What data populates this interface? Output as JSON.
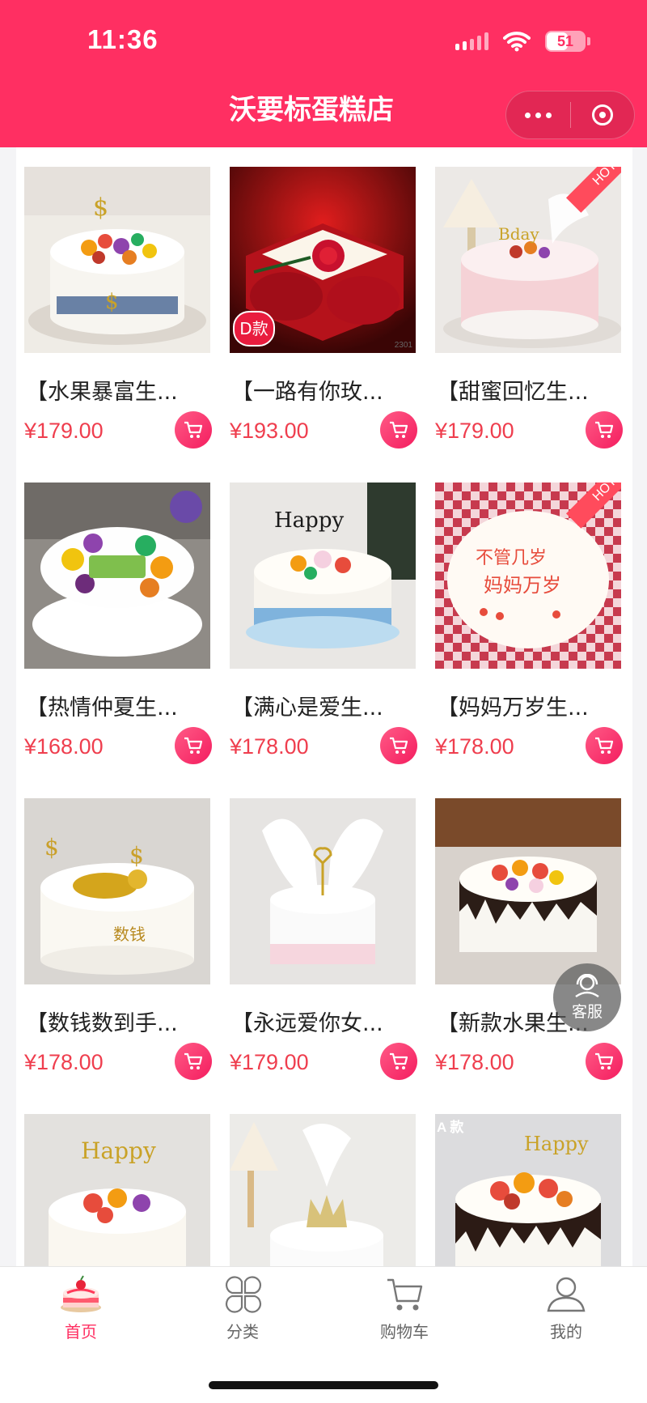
{
  "status_bar": {
    "time": "11:36",
    "battery": "51"
  },
  "nav": {
    "title": "沃要标蛋糕店"
  },
  "products": [
    {
      "name": "【水果暴富生...",
      "price": "¥179.00"
    },
    {
      "name": "【一路有你玫...",
      "price": "¥193.00",
      "image_badge": "D款",
      "image_code": "2301"
    },
    {
      "name": "【甜蜜回忆生...",
      "price": "¥179.00",
      "badge": "HOT"
    },
    {
      "name": "【热情仲夏生...",
      "price": "¥168.00"
    },
    {
      "name": "【满心是爱生...",
      "price": "¥178.00"
    },
    {
      "name": "【妈妈万岁生...",
      "price": "¥178.00",
      "badge": "HOT"
    },
    {
      "name": "【数钱数到手...",
      "price": "¥178.00"
    },
    {
      "name": "【永远爱你女...",
      "price": "¥179.00"
    },
    {
      "name": "【新款水果生...",
      "price": "¥178.00"
    },
    {
      "image_badge": ""
    },
    {
      "image_badge": ""
    },
    {
      "image_badge": "A 款"
    }
  ],
  "service": {
    "label": "客服"
  },
  "tabbar": {
    "items": [
      {
        "label": "首页",
        "icon": "cake-icon",
        "active": true
      },
      {
        "label": "分类",
        "icon": "category-icon",
        "active": false
      },
      {
        "label": "购物车",
        "icon": "cart-icon",
        "active": false
      },
      {
        "label": "我的",
        "icon": "user-icon",
        "active": false
      }
    ]
  },
  "colors": {
    "brand": "#ff2f62",
    "price": "#ef3e4e"
  }
}
